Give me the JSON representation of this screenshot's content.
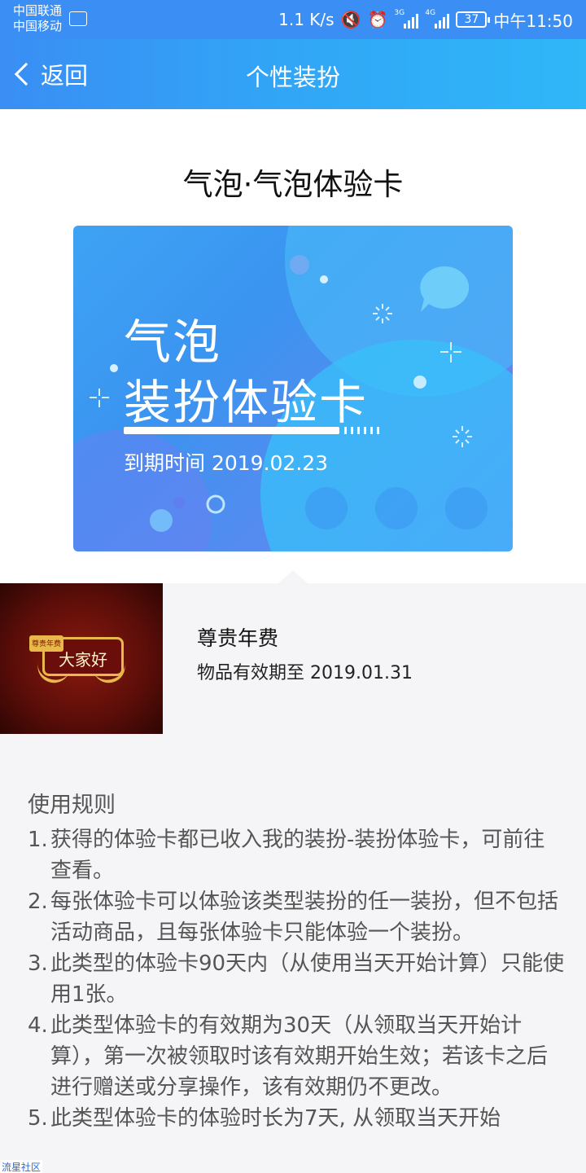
{
  "status_bar": {
    "carrier1": "中国联通",
    "carrier2": "中国移动",
    "speed": "1.1 K/s",
    "sig1_tag": "3G",
    "sig2_tag": "4G",
    "battery": "37",
    "time": "中午11:50"
  },
  "nav": {
    "back_label": "返回",
    "title": "个性装扮"
  },
  "item_title": "气泡·气泡体验卡",
  "card": {
    "line1": "气泡",
    "line2": "装扮体验卡",
    "expire": "到期时间 2019.02.23"
  },
  "item": {
    "thumb_badge": "尊贵年费",
    "thumb_text": "大家好",
    "name": "尊贵年费",
    "valid": "物品有效期至 2019.01.31"
  },
  "rules": {
    "title": "使用规则",
    "items": [
      {
        "num": "1.",
        "text": "获得的体验卡都已收入我的装扮-装扮体验卡，可前往查看。"
      },
      {
        "num": "2.",
        "text": "每张体验卡可以体验该类型装扮的任一装扮，但不包括活动商品，且每张体验卡只能体验一个装扮。"
      },
      {
        "num": "3.",
        "text": "此类型的体验卡90天内（从使用当天开始计算）只能使用1张。"
      },
      {
        "num": "4.",
        "text": "此类型体验卡的有效期为30天（从领取当天开始计算），第一次被领取时该有效期开始生效；若该卡之后进行赠送或分享操作，该有效期仍不更改。"
      },
      {
        "num": "5.",
        "text": "此类型体验卡的体验时长为7天, 从领取当天开始"
      }
    ]
  },
  "watermark": "流星社区",
  "colors": {
    "nav_start": "#3a8ef4",
    "nav_end": "#2fb7f8",
    "card_start": "#3ea3f4",
    "card_end": "#7a6ff2"
  }
}
